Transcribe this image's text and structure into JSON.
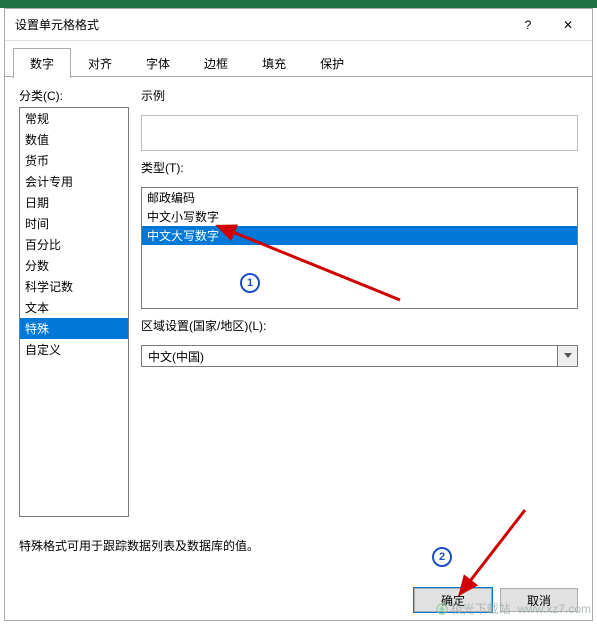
{
  "window": {
    "title": "设置单元格格式",
    "close": "✕",
    "help": "?"
  },
  "tabs": {
    "items": [
      "数字",
      "对齐",
      "字体",
      "边框",
      "填充",
      "保护"
    ],
    "activeIndex": 0
  },
  "left": {
    "label": "分类(C):",
    "items": [
      "常规",
      "数值",
      "货币",
      "会计专用",
      "日期",
      "时间",
      "百分比",
      "分数",
      "科学记数",
      "文本",
      "特殊",
      "自定义"
    ],
    "selectedIndex": 10
  },
  "right": {
    "sampleLabel": "示例",
    "typeLabel": "类型(T):",
    "types": [
      "邮政编码",
      "中文小写数字",
      "中文大写数字"
    ],
    "typeSelectedIndex": 2,
    "localeLabel": "区域设置(国家/地区)(L):",
    "localeValue": "中文(中国)"
  },
  "desc": "特殊格式可用于跟踪数据列表及数据库的值。",
  "buttons": {
    "ok": "确定",
    "cancel": "取消"
  },
  "annot": {
    "step1": "1",
    "step2": "2"
  },
  "watermark": {
    "site": "极光下载站",
    "url": "www.xz7.com"
  }
}
